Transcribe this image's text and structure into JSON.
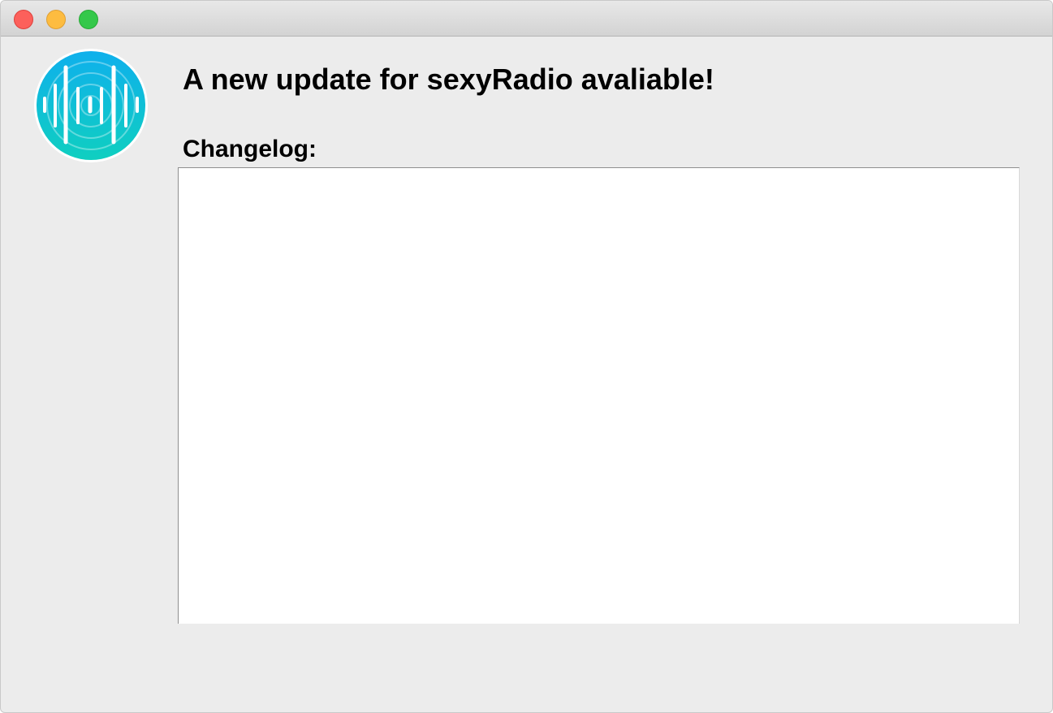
{
  "window": {
    "title": "",
    "controls": {
      "close_icon": "close-icon",
      "minimize_icon": "minimize-icon",
      "zoom_icon": "zoom-icon",
      "close_color": "#fc605b",
      "minimize_color": "#fdbc40",
      "zoom_color": "#34c84a"
    }
  },
  "app": {
    "icon": "radio-wave-app-icon",
    "icon_gradient": [
      "#0fb5e8",
      "#10c8c0"
    ]
  },
  "header": {
    "title": "A new update for sexyRadio avaliable!"
  },
  "changelog": {
    "label": "Changelog:",
    "content": ""
  }
}
